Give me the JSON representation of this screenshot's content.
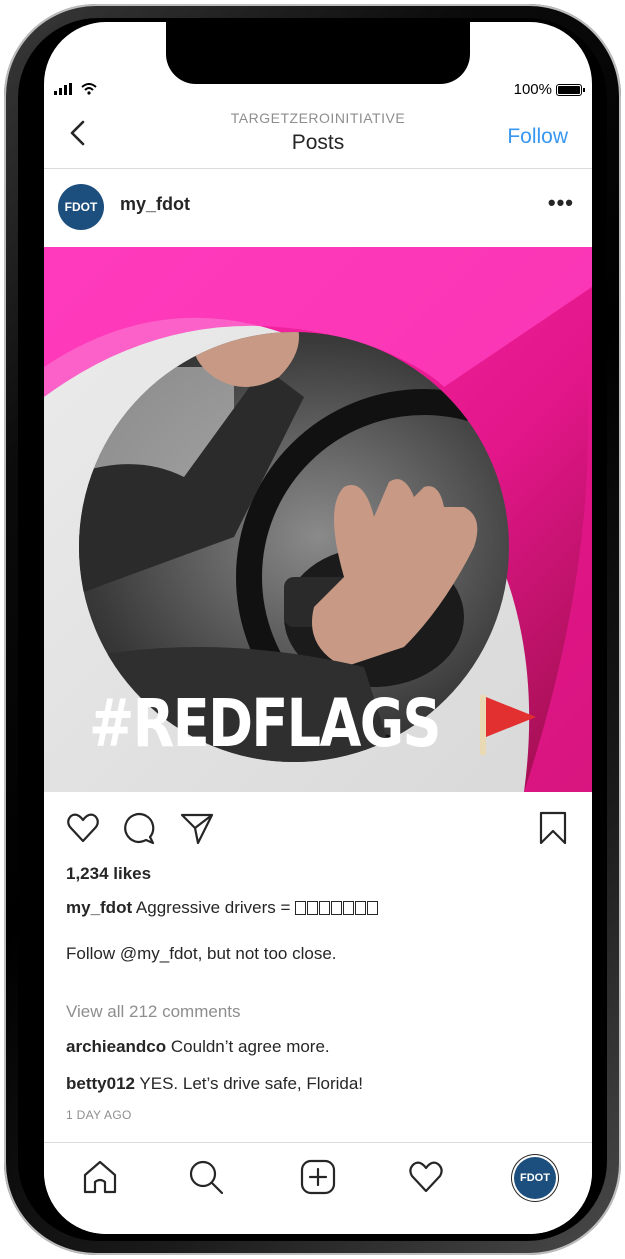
{
  "status_bar": {
    "battery": "100%",
    "battery_level": 1.0
  },
  "nav": {
    "subtitle": "TARGETZEROINITIATIVE",
    "title": "Posts",
    "follow_label": "Follow"
  },
  "post": {
    "username": "my_fdot",
    "avatar_text": "FDOT",
    "more_label": "•••",
    "image_hashtag": "#REDFLAGS",
    "likes": "1,234 likes",
    "caption_user": "my_fdot",
    "caption_text": "Aggressive drivers =",
    "caption_line2": "Follow @my_fdot, but not too close.",
    "view_comments": "View all 212 comments",
    "comments": [
      {
        "user": "archieandco",
        "text": "Couldn’t agree more."
      },
      {
        "user": "betty012",
        "text": "YES. Let’s drive safe, Florida!"
      }
    ],
    "time": "1 DAY AGO"
  },
  "bottom_nav": {
    "avatar_text": "FDOT"
  },
  "colors": {
    "accent": "#3897f0",
    "brand_blue": "#1d4f7e",
    "magenta": "#e0218a"
  }
}
